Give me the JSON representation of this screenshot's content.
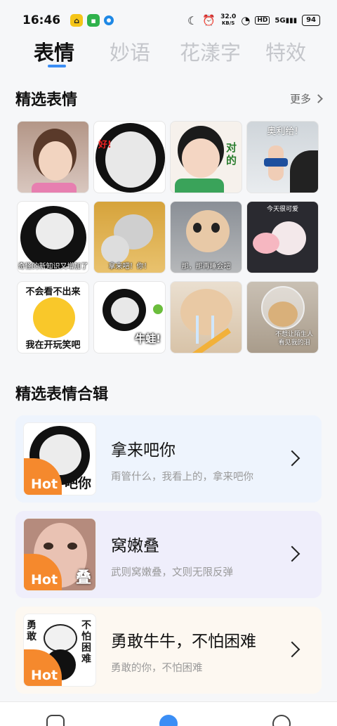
{
  "status_bar": {
    "time": "16:46",
    "app_icons": [
      "yellow-app-icon",
      "green-message-icon",
      "blue-circle-icon"
    ],
    "net_speed_value": "32.0",
    "net_speed_unit": "KB/S",
    "hd_label": "HD",
    "signal_label": "5G",
    "battery": "94"
  },
  "top_tabs": [
    {
      "label": "表情",
      "active": true
    },
    {
      "label": "妙语",
      "active": false
    },
    {
      "label": "花漾字",
      "active": false
    },
    {
      "label": "特效",
      "active": false
    }
  ],
  "featured": {
    "title": "精选表情",
    "more_label": "更多",
    "stickers": [
      {
        "top": "",
        "caption": ""
      },
      {
        "top": "好!",
        "caption": ""
      },
      {
        "top": "对的",
        "caption": ""
      },
      {
        "top": "奥利给!",
        "caption": ""
      },
      {
        "top": "",
        "caption": "奇怪的新知识又增加了"
      },
      {
        "top": "",
        "caption": "拿来吧！你！"
      },
      {
        "top": "",
        "caption": "那，那再睡会吧"
      },
      {
        "top": "今天很可爱",
        "caption": ""
      },
      {
        "top": "不会看不出来",
        "caption": "我在开玩笑吧"
      },
      {
        "top": "",
        "caption": "牛蛙!"
      },
      {
        "top": "",
        "caption": ""
      },
      {
        "top": "",
        "caption": "不想让陌生人看见我的泪"
      }
    ]
  },
  "collections": {
    "title": "精选表情合辑",
    "cards": [
      {
        "title": "拿来吧你",
        "subtitle": "甭管什么，我看上的，拿来吧你",
        "badge": "Hot",
        "thumb_caption": "吧你",
        "bg": "#eef4fd"
      },
      {
        "title": "窝嫩叠",
        "subtitle": "武则窝嫩叠，文则无限反弹",
        "badge": "Hot",
        "thumb_caption": "叠",
        "bg": "#efeefb"
      },
      {
        "title": "勇敢牛牛，不怕困难",
        "subtitle": "勇敢的你，不怕困难",
        "badge": "Hot",
        "thumb_caption": "",
        "bg": "#fdf8f1"
      }
    ]
  },
  "colors": {
    "accent": "#3b8ef5",
    "hot": "#f5892d"
  }
}
